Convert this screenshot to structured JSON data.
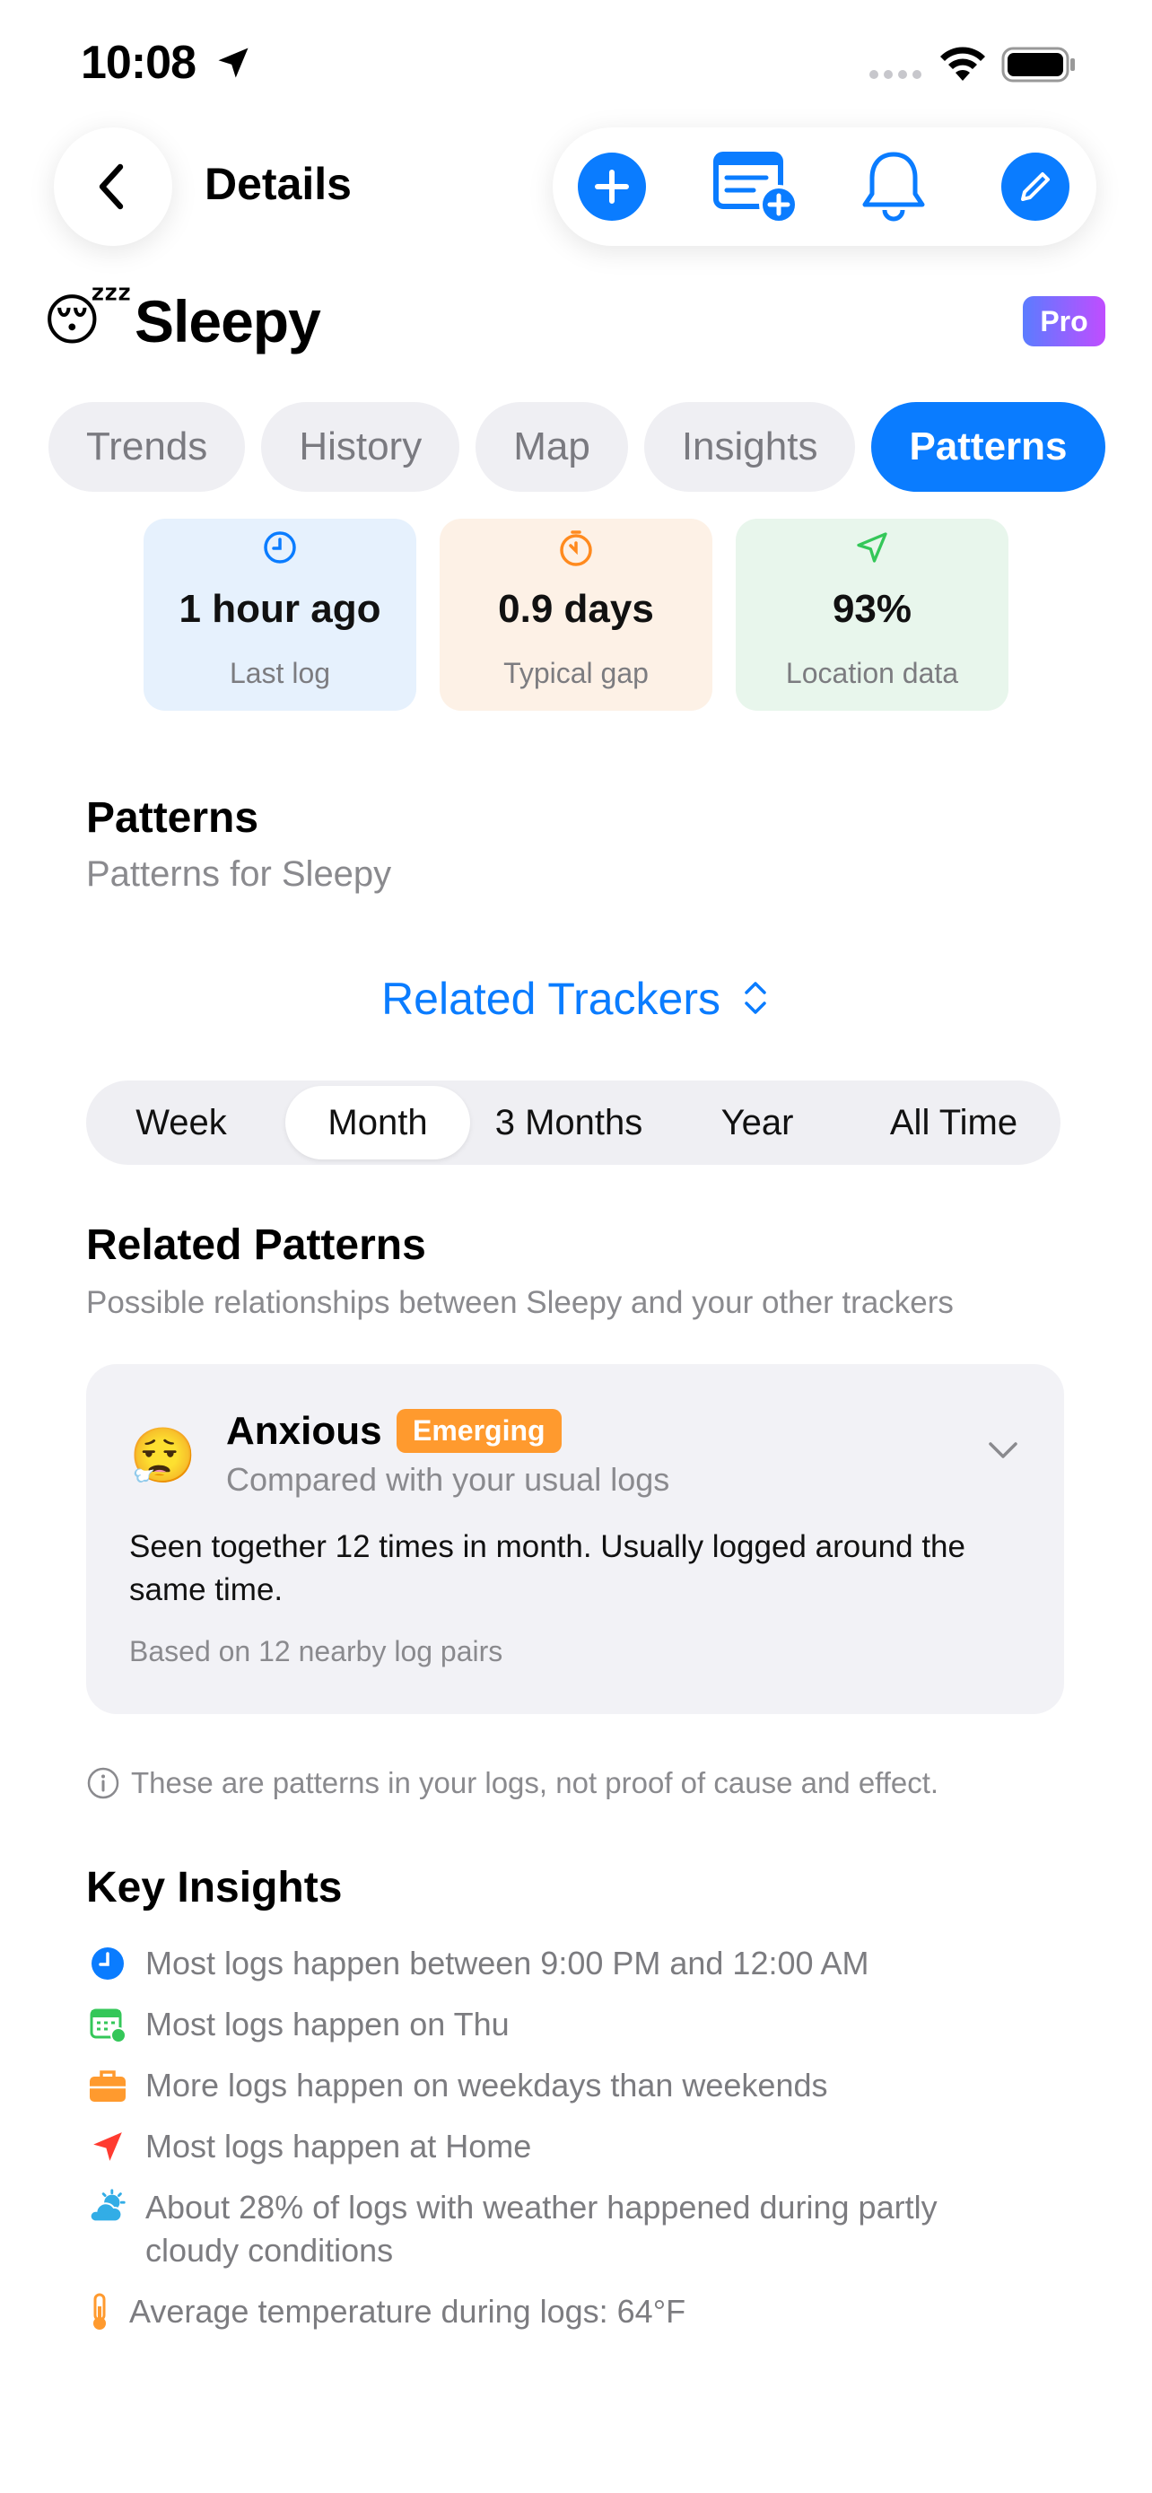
{
  "status_bar": {
    "time": "10:08"
  },
  "nav": {
    "title": "Details"
  },
  "header": {
    "emoji": "😴",
    "name": "Sleepy",
    "badge": "Pro"
  },
  "tabs": [
    "Trends",
    "History",
    "Map",
    "Insights",
    "Patterns"
  ],
  "stats": [
    {
      "value": "1 hour ago",
      "label": "Last log",
      "icon": "clock-icon"
    },
    {
      "value": "0.9 days",
      "label": "Typical gap",
      "icon": "timer-icon"
    },
    {
      "value": "93%",
      "label": "Location data",
      "icon": "location-arrow-icon"
    }
  ],
  "patterns": {
    "title": "Patterns",
    "subtitle": "Patterns for Sleepy"
  },
  "related_trackers": {
    "label": "Related Trackers"
  },
  "ranges": [
    "Week",
    "Month",
    "3 Months",
    "Year",
    "All Time"
  ],
  "range_selected": "Month",
  "related_patterns": {
    "title": "Related Patterns",
    "subtitle": "Possible relationships between Sleepy and your other trackers",
    "card": {
      "emoji": "😮‍💨",
      "name": "Anxious",
      "badge": "Emerging",
      "compare": "Compared with your usual logs",
      "body": "Seen together 12 times in month. Usually logged around the same time.",
      "footer": "Based on 12 nearby log pairs"
    },
    "disclaimer": "These are patterns in your logs, not proof of cause and effect."
  },
  "key_insights": {
    "title": "Key Insights",
    "items": [
      {
        "icon": "clock-icon",
        "text": "Most logs happen between 9:00 PM and 12:00 AM"
      },
      {
        "icon": "calendar-icon",
        "text": "Most logs happen on Thu"
      },
      {
        "icon": "briefcase-icon",
        "text": "More logs happen on weekdays than weekends"
      },
      {
        "icon": "location-arrow-icon",
        "text": "Most logs happen at Home"
      },
      {
        "icon": "partly-cloudy-icon",
        "text": "About 28% of logs with weather happened during partly cloudy conditions"
      },
      {
        "icon": "thermometer-icon",
        "text": "Average temperature during logs: 64°F"
      }
    ]
  },
  "colors": {
    "accent": "#0a7cff",
    "emerging": "#ff9a2e"
  }
}
